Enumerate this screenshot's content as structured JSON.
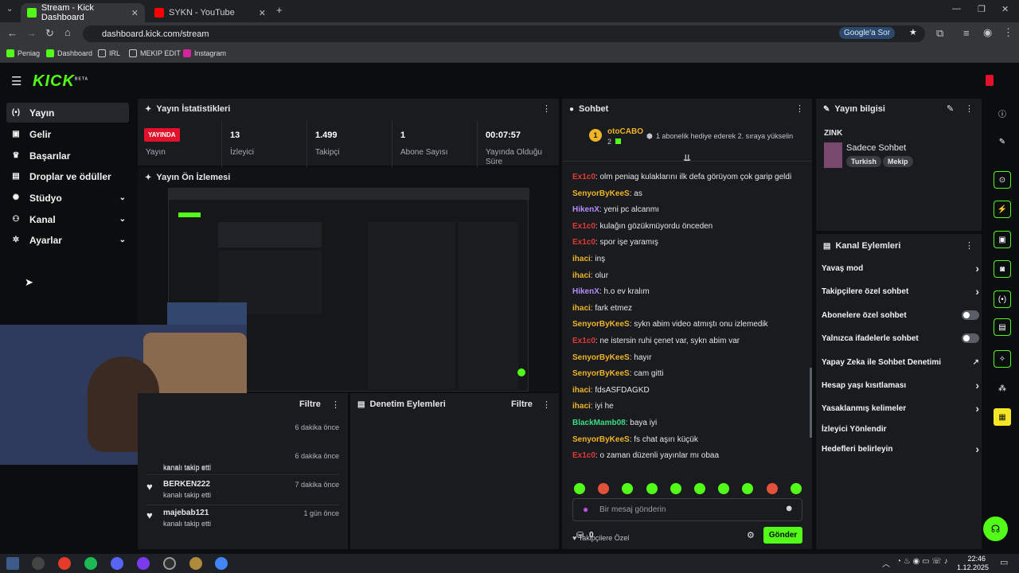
{
  "tabs": [
    {
      "title": "Stream - Kick Dashboard"
    },
    {
      "title": "SYKN - YouTube"
    }
  ],
  "address": {
    "url": "dashboard.kick.com/stream",
    "google_label": "Google'a Sor"
  },
  "bookmarks": [
    "Peniag",
    "Dashboard",
    "IRL",
    "MEKIP EDIT",
    "Instagram"
  ],
  "logo": {
    "text": "KICK",
    "badge": "BETA"
  },
  "sidebar": [
    {
      "label": "Yayın",
      "icon": "broadcast-icon"
    },
    {
      "label": "Gelir",
      "icon": "dollar-icon"
    },
    {
      "label": "Başarılar",
      "icon": "trophy-icon"
    },
    {
      "label": "Droplar ve ödüller",
      "icon": "gift-icon"
    },
    {
      "label": "Stüdyo",
      "icon": "gear-icon"
    },
    {
      "label": "Kanal",
      "icon": "users-icon"
    },
    {
      "label": "Ayarlar",
      "icon": "settings-icon"
    }
  ],
  "stats": {
    "title": "Yayın İstatistikleri",
    "live_badge": "YAYINDA",
    "items": [
      {
        "value": "",
        "label": "Yayın"
      },
      {
        "value": "13",
        "label": "İzleyici"
      },
      {
        "value": "1.499",
        "label": "Takipçi"
      },
      {
        "value": "1",
        "label": "Abone Sayısı"
      },
      {
        "value": "00:07:57",
        "label": "Yayında Olduğu Süre"
      }
    ]
  },
  "preview": {
    "title": "Yayın Ön İzlemesi"
  },
  "activity": {
    "filter_label": "Filtre",
    "items": [
      {
        "name": "",
        "action": "kanalı takip etti",
        "time": "6 dakika önce"
      },
      {
        "name": "",
        "action": "kanalı takip etti",
        "time": "6 dakika önce"
      },
      {
        "name": "BERKEN222",
        "action": "kanalı takip etti",
        "time": "7 dakika önce"
      },
      {
        "name": "majebab121",
        "action": "kanalı takip etti",
        "time": "1 gün önce"
      }
    ]
  },
  "moderation": {
    "title": "Denetim Eylemleri",
    "filter_label": "Filtre"
  },
  "chat": {
    "title": "Sohbet",
    "pinned_user": "otoCABO",
    "pinned_rank": "1",
    "pinned_count": "2",
    "pinned_text": "1 abonelik hediye ederek 2. sıraya yükselin",
    "messages": [
      {
        "user": "Ex1c0",
        "color": "#e53935",
        "text": "olm peniag kulaklarını ilk defa görüyom çok garip geldi"
      },
      {
        "user": "SenyorByKeeS",
        "color": "#f0b429",
        "text": "as"
      },
      {
        "user": "HikenX",
        "color": "#b48cff",
        "text": "yeni pc alcanmı"
      },
      {
        "user": "Ex1c0",
        "color": "#e53935",
        "text": "kulağın gözükmüyordu önceden"
      },
      {
        "user": "Ex1c0",
        "color": "#e53935",
        "text": "spor işe yaramış"
      },
      {
        "user": "ihaci",
        "color": "#f0b429",
        "text": "inş"
      },
      {
        "user": "ihaci",
        "color": "#f0b429",
        "text": "olur"
      },
      {
        "user": "HikenX",
        "color": "#b48cff",
        "text": "h.o ev kralım"
      },
      {
        "user": "ihaci",
        "color": "#f0b429",
        "text": "fark etmez"
      },
      {
        "user": "SenyorByKeeS",
        "color": "#f0b429",
        "text": "sykn abim video atmıştı onu izlemedik"
      },
      {
        "user": "Ex1c0",
        "color": "#e53935",
        "text": "ne istersin ruhi çenet var, sykn abim var"
      },
      {
        "user": "SenyorByKeeS",
        "color": "#f0b429",
        "text": "hayır"
      },
      {
        "user": "SenyorByKeeS",
        "color": "#f0b429",
        "text": "cam gitti"
      },
      {
        "user": "ihaci",
        "color": "#f0b429",
        "text": "fdsASFDAGKD"
      },
      {
        "user": "ihaci",
        "color": "#f0b429",
        "text": "iyi he"
      },
      {
        "user": "BlackMamb08",
        "color": "#3ddc84",
        "text": "baya iyi"
      },
      {
        "user": "SenyorByKeeS",
        "color": "#f0b429",
        "text": "fs chat aşırı küçük"
      },
      {
        "user": "Ex1c0",
        "color": "#e53935",
        "text": "o zaman düzenli yayınlar mı obaa"
      }
    ],
    "followers_only": "Takipçilere Özel",
    "input_placeholder": "Bir mesaj gönderin",
    "points": "0",
    "send_label": "Gönder"
  },
  "info": {
    "title": "Yayın bilgisi",
    "category": "ZINK",
    "stream_title": "Sadece Sohbet",
    "tags": [
      "Turkish",
      "Mekip"
    ]
  },
  "channel_actions": {
    "title": "Kanal Eylemleri",
    "items": [
      {
        "label": "Yavaş mod",
        "control": "chevron"
      },
      {
        "label": "Takipçilere özel sohbet",
        "control": "chevron"
      },
      {
        "label": "Abonelere özel sohbet",
        "control": "toggle"
      },
      {
        "label": "Yalnızca ifadelerle sohbet",
        "control": "toggle"
      },
      {
        "label": "Yapay Zeka ile Sohbet Denetimi",
        "control": "external"
      },
      {
        "label": "Hesap yaşı kısıtlaması",
        "control": "chevron"
      },
      {
        "label": "Yasaklanmış kelimeler",
        "control": "chevron"
      },
      {
        "label": "İzleyici Yönlendir",
        "control": "none"
      },
      {
        "label": "Hedefleri belirleyin",
        "control": "chevron"
      }
    ]
  },
  "clock": {
    "time": "22:46",
    "date": "1.12.2025"
  },
  "colors": {
    "accent": "#53fc18",
    "live": "#e3102a",
    "panel": "#191b1f"
  }
}
